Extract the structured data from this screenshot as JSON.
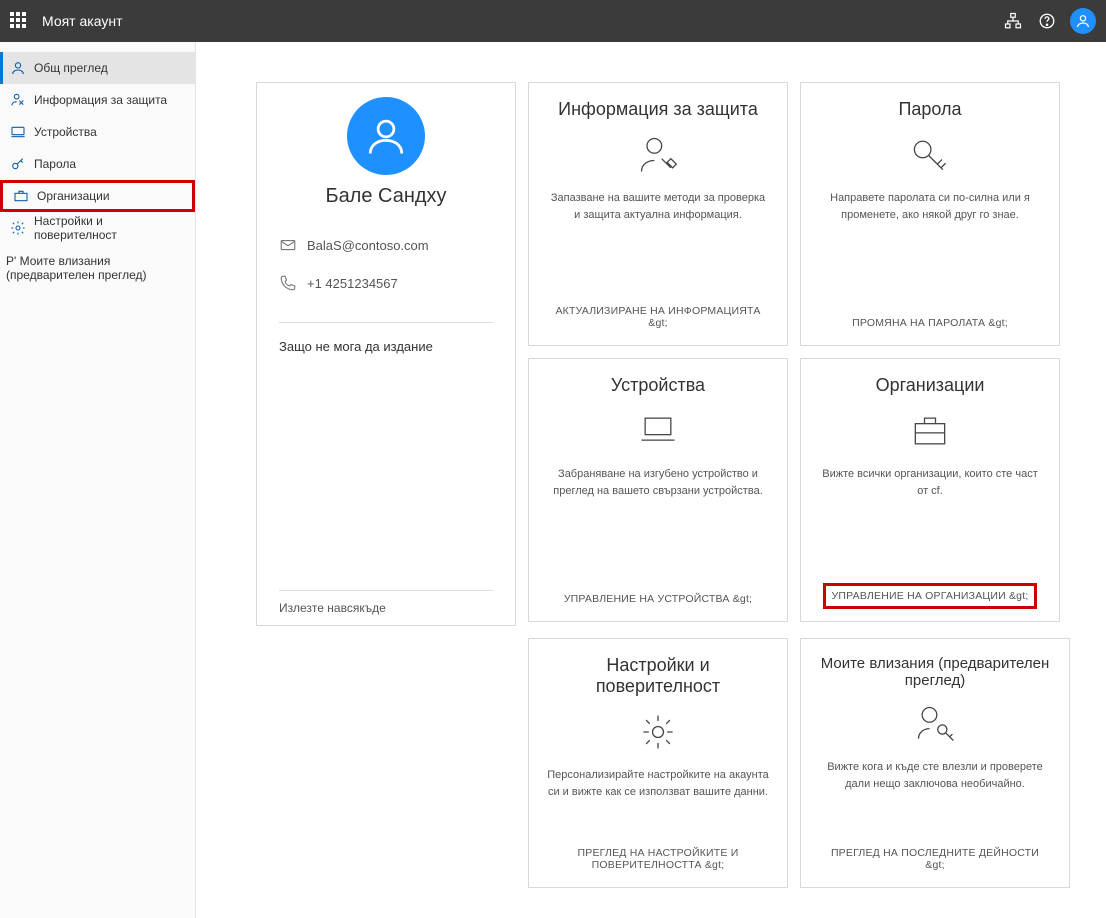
{
  "topbar": {
    "title": "Моят акаунт"
  },
  "sidebar": {
    "items": [
      {
        "label": "Общ преглед"
      },
      {
        "label": "Информация за защита"
      },
      {
        "label": "Устройства"
      },
      {
        "label": "Парола"
      },
      {
        "label": "Организации"
      },
      {
        "label": "Настройки и поверителност"
      }
    ],
    "overflow": "Р' Моите влизания (предварителен преглед)"
  },
  "profile": {
    "first": "Бале",
    "last": "Сандху",
    "email": "BalaS@contoso.com",
    "phone": "+1 4251234567",
    "question": "Защо не мога да издание",
    "signout": "Излезте навсякъде"
  },
  "tiles": {
    "security": {
      "title": "Информация за защита",
      "desc": "Запазване на вашите методи за проверка и защита актуална информация.",
      "action": "АКТУАЛИЗИРАНЕ НА ИНФОРМАЦИЯТА &gt;"
    },
    "password": {
      "title": "Парола",
      "desc": "Направете паролата си по-силна или я променете, ако някой друг го знае.",
      "action": "ПРОМЯНА НА ПАРОЛАТА &gt;"
    },
    "devices": {
      "title": "Устройства",
      "desc": "Забраняване на изгубено устройство и преглед на вашето свързани устройства.",
      "action": "УПРАВЛЕНИЕ НА УСТРОЙСТВА &gt;"
    },
    "orgs": {
      "title": "Организации",
      "desc": "Вижте всички организации, които сте част от cf.",
      "action": "УПРАВЛЕНИЕ НА ОРГАНИЗАЦИИ &gt;"
    },
    "settings": {
      "title": "Настройки и поверителност",
      "desc": "Персонализирайте настройките на акаунта си и вижте как се използват вашите данни.",
      "action": "ПРЕГЛЕД НА НАСТРОЙКИТЕ И ПОВЕРИТЕЛНОСТТА &gt;"
    },
    "signins": {
      "title": "Моите влизания (предварителен преглед)",
      "desc": "Вижте кога и къде сте влезли и проверете дали нещо заключова необичайно.",
      "action": "ПРЕГЛЕД НА ПОСЛЕДНИТЕ ДЕЙНОСТИ &gt;"
    }
  }
}
